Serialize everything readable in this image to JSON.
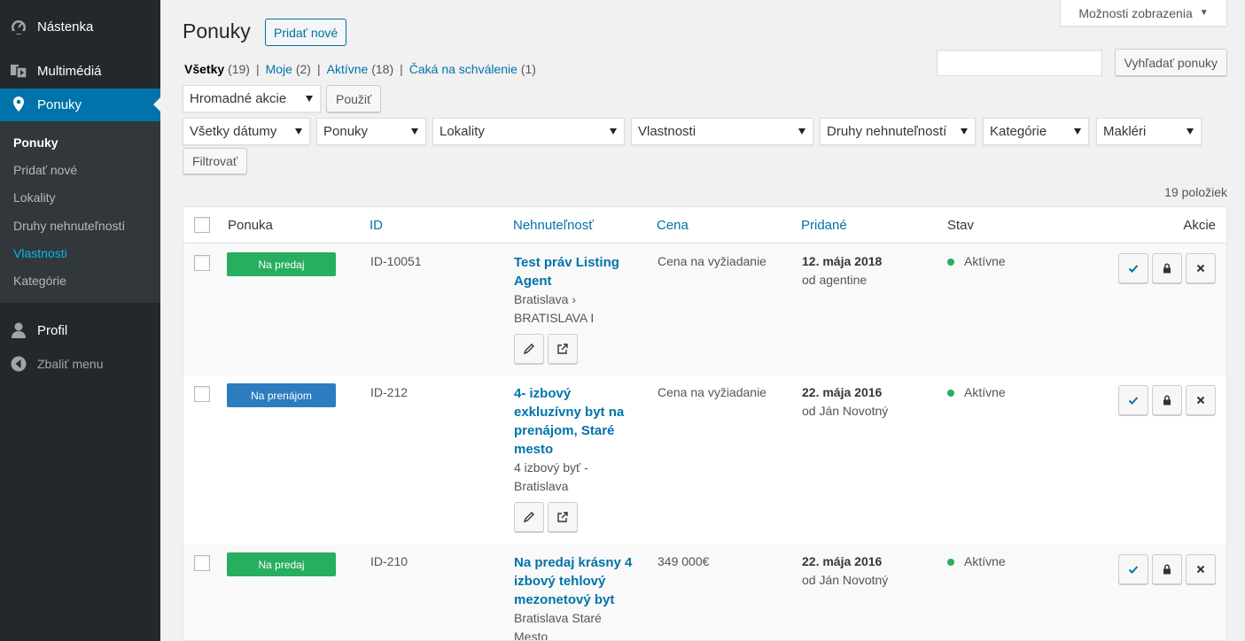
{
  "sidebar": {
    "menu": [
      {
        "label": "Nástenka",
        "icon": "dashboard-icon"
      },
      {
        "label": "Multimédiá",
        "icon": "media-icon"
      },
      {
        "label": "Ponuky",
        "icon": "location-pin-icon"
      },
      {
        "label": "Profil",
        "icon": "user-icon"
      },
      {
        "label": "Zbaliť menu",
        "icon": "collapse-icon"
      }
    ],
    "submenu": [
      "Ponuky",
      "Pridať nové",
      "Lokality",
      "Druhy nehnuteľností",
      "Vlastnosti",
      "Kategórie"
    ]
  },
  "header": {
    "title": "Ponuky",
    "add_new": "Pridať nové",
    "screen_options": "Možnosti zobrazenia"
  },
  "views": [
    {
      "label": "Všetky",
      "count": "(19)"
    },
    {
      "label": "Moje",
      "count": "(2)"
    },
    {
      "label": "Aktívne",
      "count": "(18)"
    },
    {
      "label": "Čaká na schválenie",
      "count": "(1)"
    }
  ],
  "search": {
    "button": "Vyhľadať ponuky",
    "value": ""
  },
  "bulk": {
    "select": "Hromadné akcie",
    "apply": "Použiť"
  },
  "filters": {
    "dates": "Všetky dátumy",
    "offers": "Ponuky",
    "locations": "Lokality",
    "properties": "Vlastnosti",
    "types": "Druhy nehnuteľností",
    "categories": "Kategórie",
    "agents": "Makléri",
    "filter_button": "Filtrovať"
  },
  "items_count": "19 položiek",
  "columns": {
    "offer": "Ponuka",
    "id": "ID",
    "property": "Nehnuteľnosť",
    "price": "Cena",
    "added": "Pridané",
    "status": "Stav",
    "actions": "Akcie"
  },
  "colors": {
    "sale": "#27ae60",
    "rent": "#2c7cbf",
    "active_dot": "#27ae60",
    "accent": "#0073aa"
  },
  "rows": [
    {
      "badge": "Na predaj",
      "badge_type": "sale",
      "id": "ID-10051",
      "title_lines": [
        "Test práv Listing",
        "Agent"
      ],
      "location_lines": [
        "Bratislava ›",
        "BRATISLAVA I"
      ],
      "price": "Cena na vyžiadanie",
      "date": "12. mája 2018",
      "by": "od agentine",
      "status": "Aktívne"
    },
    {
      "badge": "Na prenájom",
      "badge_type": "rent",
      "id": "ID-212",
      "title_lines": [
        "4- izbový",
        "exkluzívny byt na",
        "prenájom, Staré",
        "mesto"
      ],
      "location_lines": [
        "4 izbový byť -",
        "Bratislava"
      ],
      "price": "Cena na vyžiadanie",
      "date": "22. mája 2016",
      "by": "od Ján Novotný",
      "status": "Aktívne"
    },
    {
      "badge": "Na predaj",
      "badge_type": "sale",
      "id": "ID-210",
      "title_lines": [
        "Na predaj krásny 4",
        "izbový tehlový",
        "mezonetový byt"
      ],
      "location_lines": [
        "Bratislava Staré",
        "Mesto"
      ],
      "price": "349 000€",
      "date": "22. mája 2016",
      "by": "od Ján Novotný",
      "status": "Aktívne"
    }
  ]
}
